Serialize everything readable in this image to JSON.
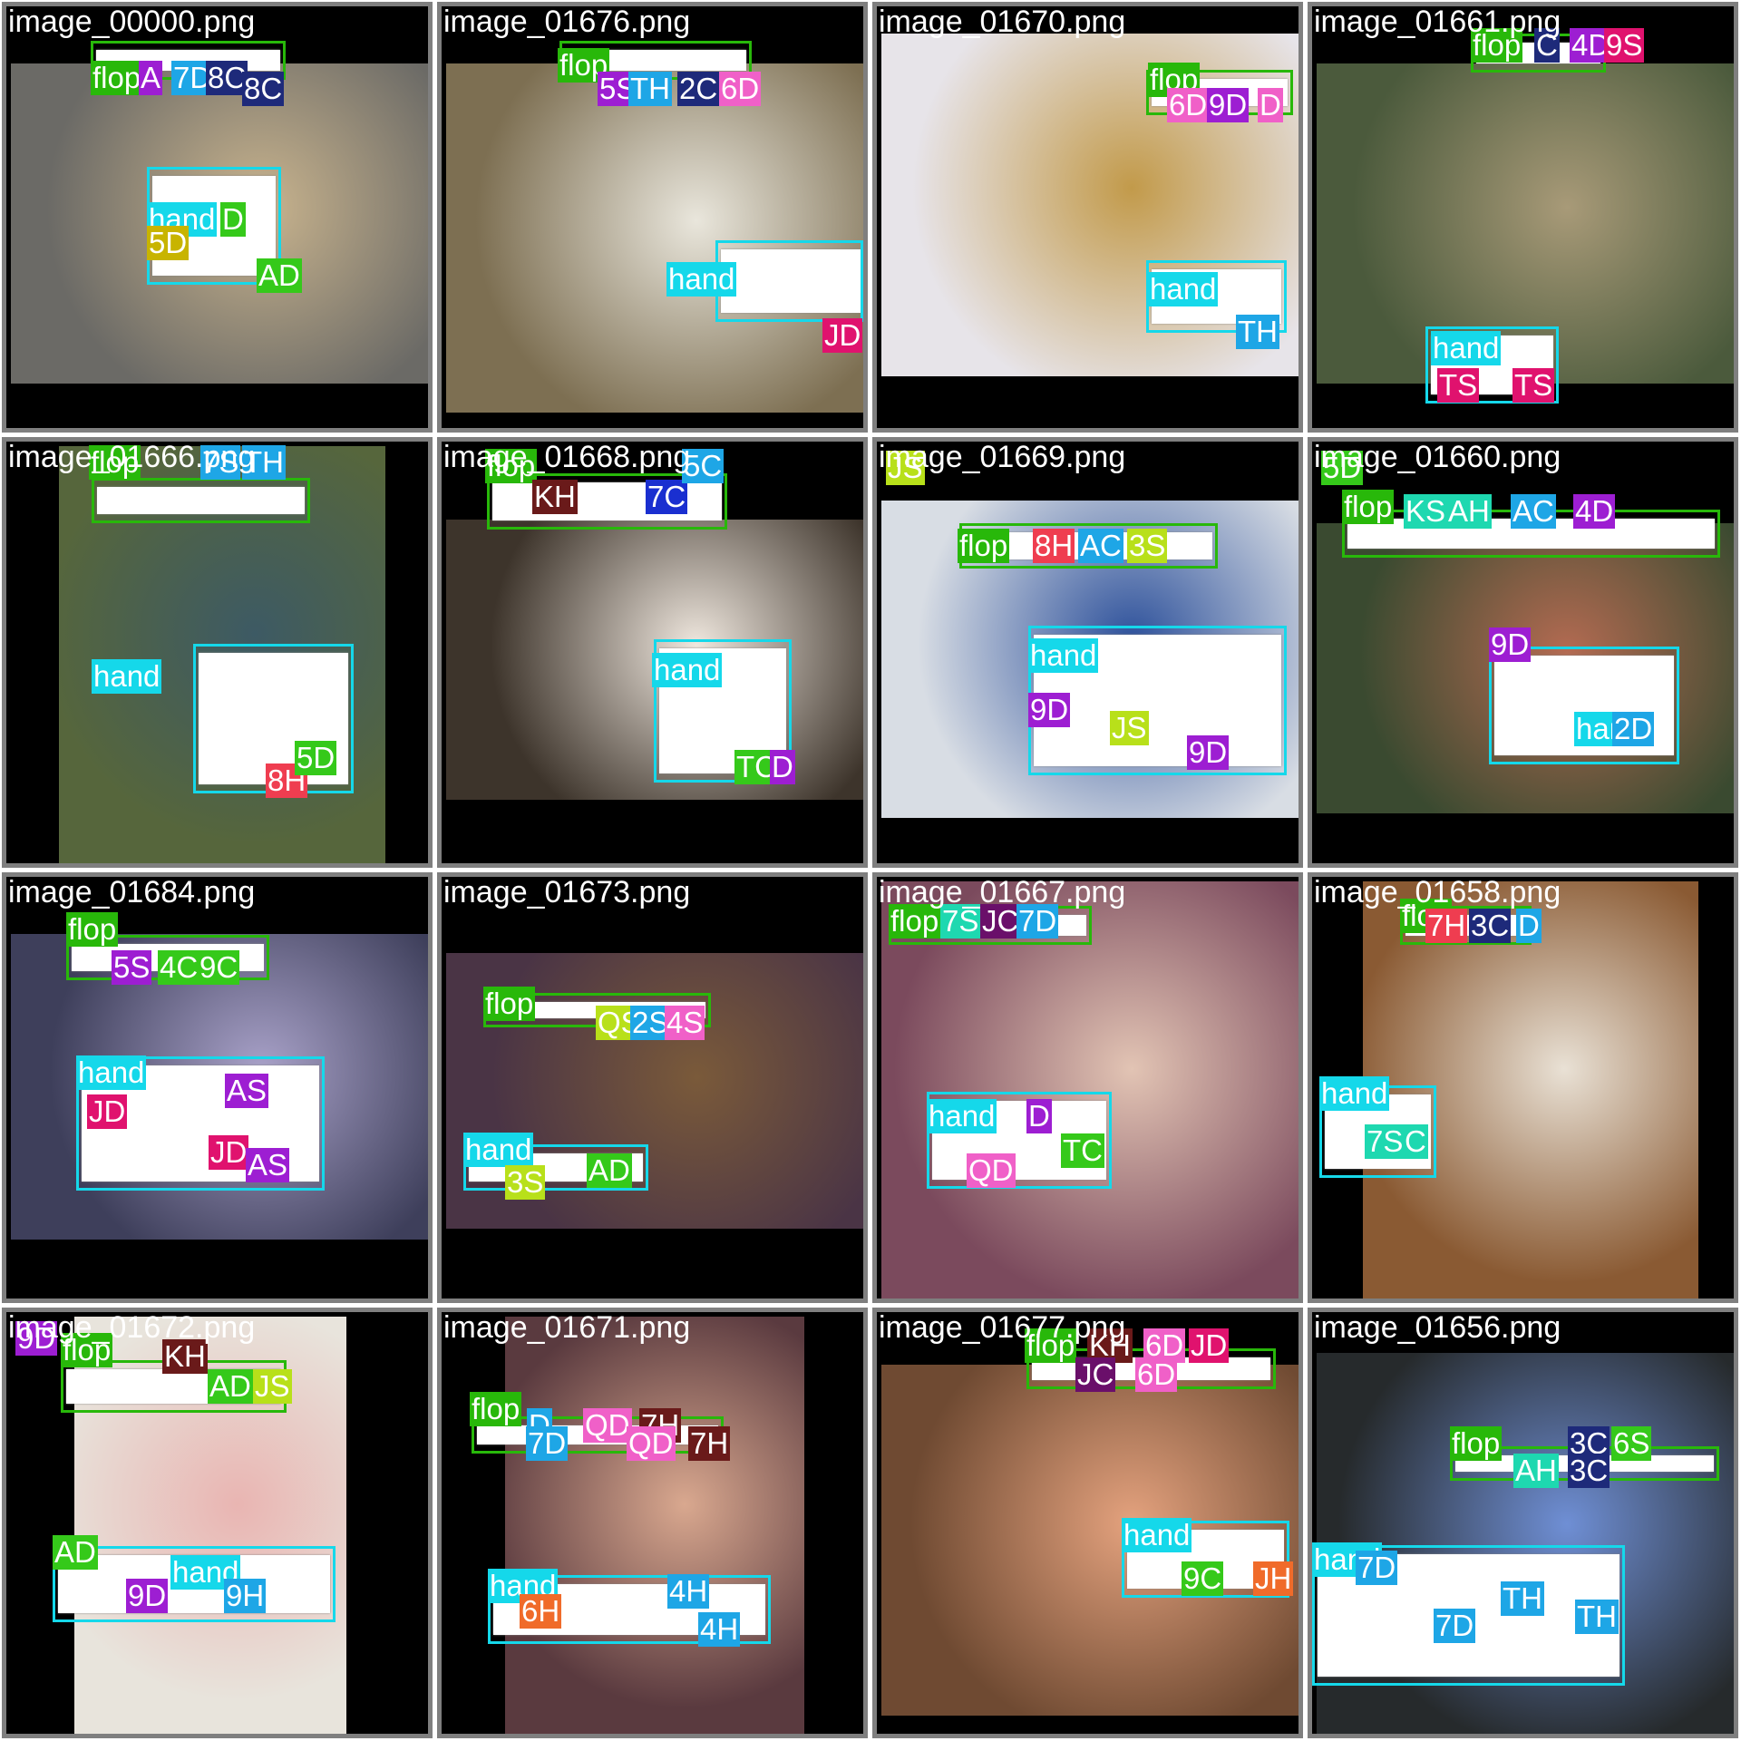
{
  "tiles": [
    {
      "name": "image_00000.png",
      "bg": "#6b6a66",
      "accent": "#c9b48e",
      "labels": [
        {
          "text": "flop",
          "cls": "flop"
        },
        {
          "text": "A",
          "cls": "c1"
        },
        {
          "text": "7D",
          "cls": "c2"
        },
        {
          "text": "8C",
          "cls": "c3"
        },
        {
          "text": "8C",
          "cls": "c3"
        },
        {
          "text": "hand",
          "cls": "hand"
        },
        {
          "text": "D",
          "cls": "c4"
        },
        {
          "text": "5D",
          "cls": "c5"
        },
        {
          "text": "AD",
          "cls": "c4"
        }
      ]
    },
    {
      "name": "image_01676.png",
      "bg": "#7d6f52",
      "accent": "#e9e6dc",
      "labels": [
        {
          "text": "flop",
          "cls": "flop"
        },
        {
          "text": "5S",
          "cls": "c1"
        },
        {
          "text": "TH",
          "cls": "c2"
        },
        {
          "text": "2C",
          "cls": "c3"
        },
        {
          "text": "6D",
          "cls": "c6"
        },
        {
          "text": "hand",
          "cls": "hand"
        },
        {
          "text": "JD",
          "cls": "c7"
        }
      ]
    },
    {
      "name": "image_01670.png",
      "bg": "#e7e4e9",
      "accent": "#c29a4a",
      "labels": [
        {
          "text": "flop",
          "cls": "flop"
        },
        {
          "text": "6D",
          "cls": "c6"
        },
        {
          "text": "9D",
          "cls": "c1"
        },
        {
          "text": "D",
          "cls": "c6"
        },
        {
          "text": "hand",
          "cls": "hand"
        },
        {
          "text": "TH",
          "cls": "c2"
        }
      ]
    },
    {
      "name": "image_01661.png",
      "bg": "#4b5a3c",
      "accent": "#a89a78",
      "labels": [
        {
          "text": "flop",
          "cls": "flop"
        },
        {
          "text": "C",
          "cls": "c3"
        },
        {
          "text": "4D",
          "cls": "c1"
        },
        {
          "text": "9S",
          "cls": "c7"
        },
        {
          "text": "hand",
          "cls": "hand"
        },
        {
          "text": "TS",
          "cls": "c7"
        },
        {
          "text": "TS",
          "cls": "c7"
        }
      ]
    },
    {
      "name": "image_01666.png",
      "bg": "#56663c",
      "accent": "#3d5a64",
      "labels": [
        {
          "text": "flop",
          "cls": "flop"
        },
        {
          "text": "7S",
          "cls": "c2"
        },
        {
          "text": "TH",
          "cls": "c2"
        },
        {
          "text": "hand",
          "cls": "hand"
        },
        {
          "text": "8H",
          "cls": "c8"
        },
        {
          "text": "5D",
          "cls": "c4"
        }
      ]
    },
    {
      "name": "image_01668.png",
      "bg": "#3d342b",
      "accent": "#efe7de",
      "labels": [
        {
          "text": "flop",
          "cls": "flop"
        },
        {
          "text": "KH",
          "cls": "c9"
        },
        {
          "text": "7C",
          "cls": "c10"
        },
        {
          "text": "5C",
          "cls": "c2"
        },
        {
          "text": "hand",
          "cls": "hand"
        },
        {
          "text": "TC",
          "cls": "c4"
        },
        {
          "text": "D",
          "cls": "c1"
        }
      ]
    },
    {
      "name": "image_01669.png",
      "bg": "#d8dde4",
      "accent": "#2b4f9a",
      "labels": [
        {
          "text": "flop",
          "cls": "flop"
        },
        {
          "text": "8H",
          "cls": "c8"
        },
        {
          "text": "AC",
          "cls": "c2"
        },
        {
          "text": "3S",
          "cls": "c11"
        },
        {
          "text": "hand",
          "cls": "hand"
        },
        {
          "text": "9D",
          "cls": "c1"
        },
        {
          "text": "JS",
          "cls": "c11"
        },
        {
          "text": "9D",
          "cls": "c1"
        },
        {
          "text": "JS",
          "cls": "c11"
        }
      ]
    },
    {
      "name": "image_01660.png",
      "bg": "#3a4a30",
      "accent": "#b46b52",
      "labels": [
        {
          "text": "flop",
          "cls": "flop"
        },
        {
          "text": "KS",
          "cls": "c12"
        },
        {
          "text": "AH",
          "cls": "c12"
        },
        {
          "text": "AC",
          "cls": "c2"
        },
        {
          "text": "4D",
          "cls": "c1"
        },
        {
          "text": "9D",
          "cls": "c1"
        },
        {
          "text": "hand",
          "cls": "hand"
        },
        {
          "text": "2D",
          "cls": "c2"
        },
        {
          "text": "5D",
          "cls": "c4"
        }
      ]
    },
    {
      "name": "image_01684.png",
      "bg": "#3e3f5b",
      "accent": "#a9a2c9",
      "labels": [
        {
          "text": "flop",
          "cls": "flop"
        },
        {
          "text": "5S",
          "cls": "c1"
        },
        {
          "text": "4C",
          "cls": "c4"
        },
        {
          "text": "9C",
          "cls": "c4"
        },
        {
          "text": "hand",
          "cls": "hand"
        },
        {
          "text": "JD",
          "cls": "c7"
        },
        {
          "text": "AS",
          "cls": "c1"
        },
        {
          "text": "JD",
          "cls": "c7"
        },
        {
          "text": "AS",
          "cls": "c1"
        }
      ]
    },
    {
      "name": "image_01673.png",
      "bg": "#4a3445",
      "accent": "#7a5a3a",
      "labels": [
        {
          "text": "flop",
          "cls": "flop"
        },
        {
          "text": "QS",
          "cls": "c11"
        },
        {
          "text": "2S",
          "cls": "c2"
        },
        {
          "text": "4S",
          "cls": "c6"
        },
        {
          "text": "hand",
          "cls": "hand"
        },
        {
          "text": "3S",
          "cls": "c11"
        },
        {
          "text": "AD",
          "cls": "c4"
        }
      ]
    },
    {
      "name": "image_01667.png",
      "bg": "#7b4a5d",
      "accent": "#e2c4b4",
      "labels": [
        {
          "text": "flop",
          "cls": "flop"
        },
        {
          "text": "7S",
          "cls": "c12"
        },
        {
          "text": "JC",
          "cls": "c13"
        },
        {
          "text": "7D",
          "cls": "c2"
        },
        {
          "text": "hand",
          "cls": "hand"
        },
        {
          "text": "D",
          "cls": "c1"
        },
        {
          "text": "TC",
          "cls": "c4"
        },
        {
          "text": "QD",
          "cls": "c6"
        }
      ]
    },
    {
      "name": "image_01658.png",
      "bg": "#8a5a33",
      "accent": "#e9e1d5",
      "labels": [
        {
          "text": "flop",
          "cls": "flop"
        },
        {
          "text": "7H",
          "cls": "c8"
        },
        {
          "text": "3C",
          "cls": "c3"
        },
        {
          "text": "D",
          "cls": "c2"
        },
        {
          "text": "hand",
          "cls": "hand"
        },
        {
          "text": "7S",
          "cls": "c12"
        },
        {
          "text": "C",
          "cls": "c12"
        }
      ]
    },
    {
      "name": "image_01672.png",
      "bg": "#e8e4dc",
      "accent": "#e9b5b2",
      "labels": [
        {
          "text": "flop",
          "cls": "flop"
        },
        {
          "text": "KH",
          "cls": "c9"
        },
        {
          "text": "AD",
          "cls": "c4"
        },
        {
          "text": "JS",
          "cls": "c11"
        },
        {
          "text": "AD",
          "cls": "c4"
        },
        {
          "text": "hand",
          "cls": "hand"
        },
        {
          "text": "9D",
          "cls": "c1"
        },
        {
          "text": "9H",
          "cls": "c2"
        },
        {
          "text": "9D",
          "cls": "c1"
        }
      ]
    },
    {
      "name": "image_01671.png",
      "bg": "#5a3a3f",
      "accent": "#d9a88f",
      "labels": [
        {
          "text": "flop",
          "cls": "flop"
        },
        {
          "text": "D",
          "cls": "c2"
        },
        {
          "text": "QD",
          "cls": "c6"
        },
        {
          "text": "7H",
          "cls": "c9"
        },
        {
          "text": "7D",
          "cls": "c2"
        },
        {
          "text": "QD",
          "cls": "c6"
        },
        {
          "text": "7H",
          "cls": "c9"
        },
        {
          "text": "hand",
          "cls": "hand"
        },
        {
          "text": "6H",
          "cls": "c14"
        },
        {
          "text": "4H",
          "cls": "c2"
        },
        {
          "text": "4H",
          "cls": "c2"
        }
      ]
    },
    {
      "name": "image_01677.png",
      "bg": "#6f4a32",
      "accent": "#e4a27e",
      "labels": [
        {
          "text": "flop",
          "cls": "flop"
        },
        {
          "text": "KH",
          "cls": "c9"
        },
        {
          "text": "6D",
          "cls": "c6"
        },
        {
          "text": "JD",
          "cls": "c7"
        },
        {
          "text": "JC",
          "cls": "c13"
        },
        {
          "text": "6D",
          "cls": "c6"
        },
        {
          "text": "hand",
          "cls": "hand"
        },
        {
          "text": "9C",
          "cls": "c4"
        },
        {
          "text": "JH",
          "cls": "c14"
        }
      ]
    },
    {
      "name": "image_01656.png",
      "bg": "#262a2c",
      "accent": "#6f8fd5",
      "labels": [
        {
          "text": "flop",
          "cls": "flop"
        },
        {
          "text": "AH",
          "cls": "c12"
        },
        {
          "text": "3C",
          "cls": "c3"
        },
        {
          "text": "6S",
          "cls": "c4"
        },
        {
          "text": "3C",
          "cls": "c3"
        },
        {
          "text": "hand",
          "cls": "hand"
        },
        {
          "text": "7D",
          "cls": "c2"
        },
        {
          "text": "TH",
          "cls": "c2"
        },
        {
          "text": "7D",
          "cls": "c2"
        },
        {
          "text": "TH",
          "cls": "c2"
        }
      ]
    }
  ],
  "colors": {
    "flop": "#28b80a",
    "hand": "#15d8ea",
    "c1": "#9d1ed2",
    "c2": "#1ea6e6",
    "c3": "#1e2a7a",
    "c4": "#35c91a",
    "c5": "#c8b400",
    "c6": "#f060c8",
    "c7": "#e0126e",
    "c8": "#ef3d50",
    "c9": "#6a1a1a",
    "c10": "#1a2fd0",
    "c11": "#b8e01a",
    "c12": "#1ed8b0",
    "c13": "#6a0f6a",
    "c14": "#f06b2a"
  }
}
